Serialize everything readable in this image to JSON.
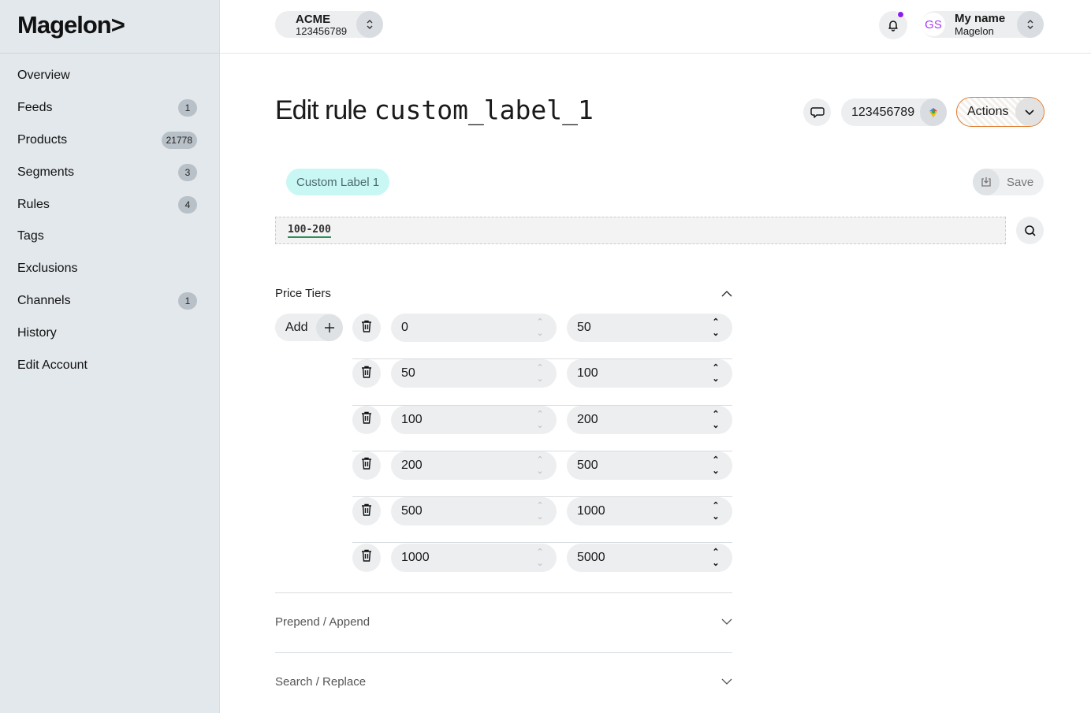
{
  "brand": {
    "logo": "Magelon>"
  },
  "sidebar": {
    "items": [
      {
        "label": "Overview",
        "badge": ""
      },
      {
        "label": "Feeds",
        "badge": "1"
      },
      {
        "label": "Products",
        "badge": "21778"
      },
      {
        "label": "Segments",
        "badge": "3"
      },
      {
        "label": "Rules",
        "badge": "4"
      },
      {
        "label": "Tags",
        "badge": ""
      },
      {
        "label": "Exclusions",
        "badge": ""
      },
      {
        "label": "Channels",
        "badge": "1"
      },
      {
        "label": "History",
        "badge": ""
      },
      {
        "label": "Edit Account",
        "badge": ""
      }
    ]
  },
  "header": {
    "account_name": "ACME",
    "account_id": "123456789",
    "user_initials": "GS",
    "user_name": "My name",
    "user_org": "Magelon"
  },
  "page": {
    "title_prefix": "Edit rule",
    "title_code": "custom_label_1",
    "merchant_id": "123456789",
    "actions_label": "Actions",
    "label_chip": "Custom Label 1",
    "save_label": "Save",
    "preview_value": "100-200"
  },
  "sections": {
    "price_tiers": "Price Tiers",
    "prepend_append": "Prepend / Append",
    "search_replace": "Search / Replace",
    "add_label": "Add"
  },
  "tiers": [
    {
      "from": "0",
      "to": "50"
    },
    {
      "from": "50",
      "to": "100"
    },
    {
      "from": "100",
      "to": "200"
    },
    {
      "from": "200",
      "to": "500"
    },
    {
      "from": "500",
      "to": "1000"
    },
    {
      "from": "1000",
      "to": "5000"
    }
  ],
  "colors": {
    "accent_orange": "#e07b2e",
    "chip_bg": "#c9f7f4",
    "notification": "#8a1cf0",
    "underline_green": "#2f8f5a"
  },
  "icons": [
    "bell-icon",
    "chevron-updown-icon",
    "chat-icon",
    "google-icon",
    "chevron-down-icon",
    "save-icon",
    "search-icon",
    "plus-icon",
    "trash-icon",
    "chevron-up-icon"
  ]
}
